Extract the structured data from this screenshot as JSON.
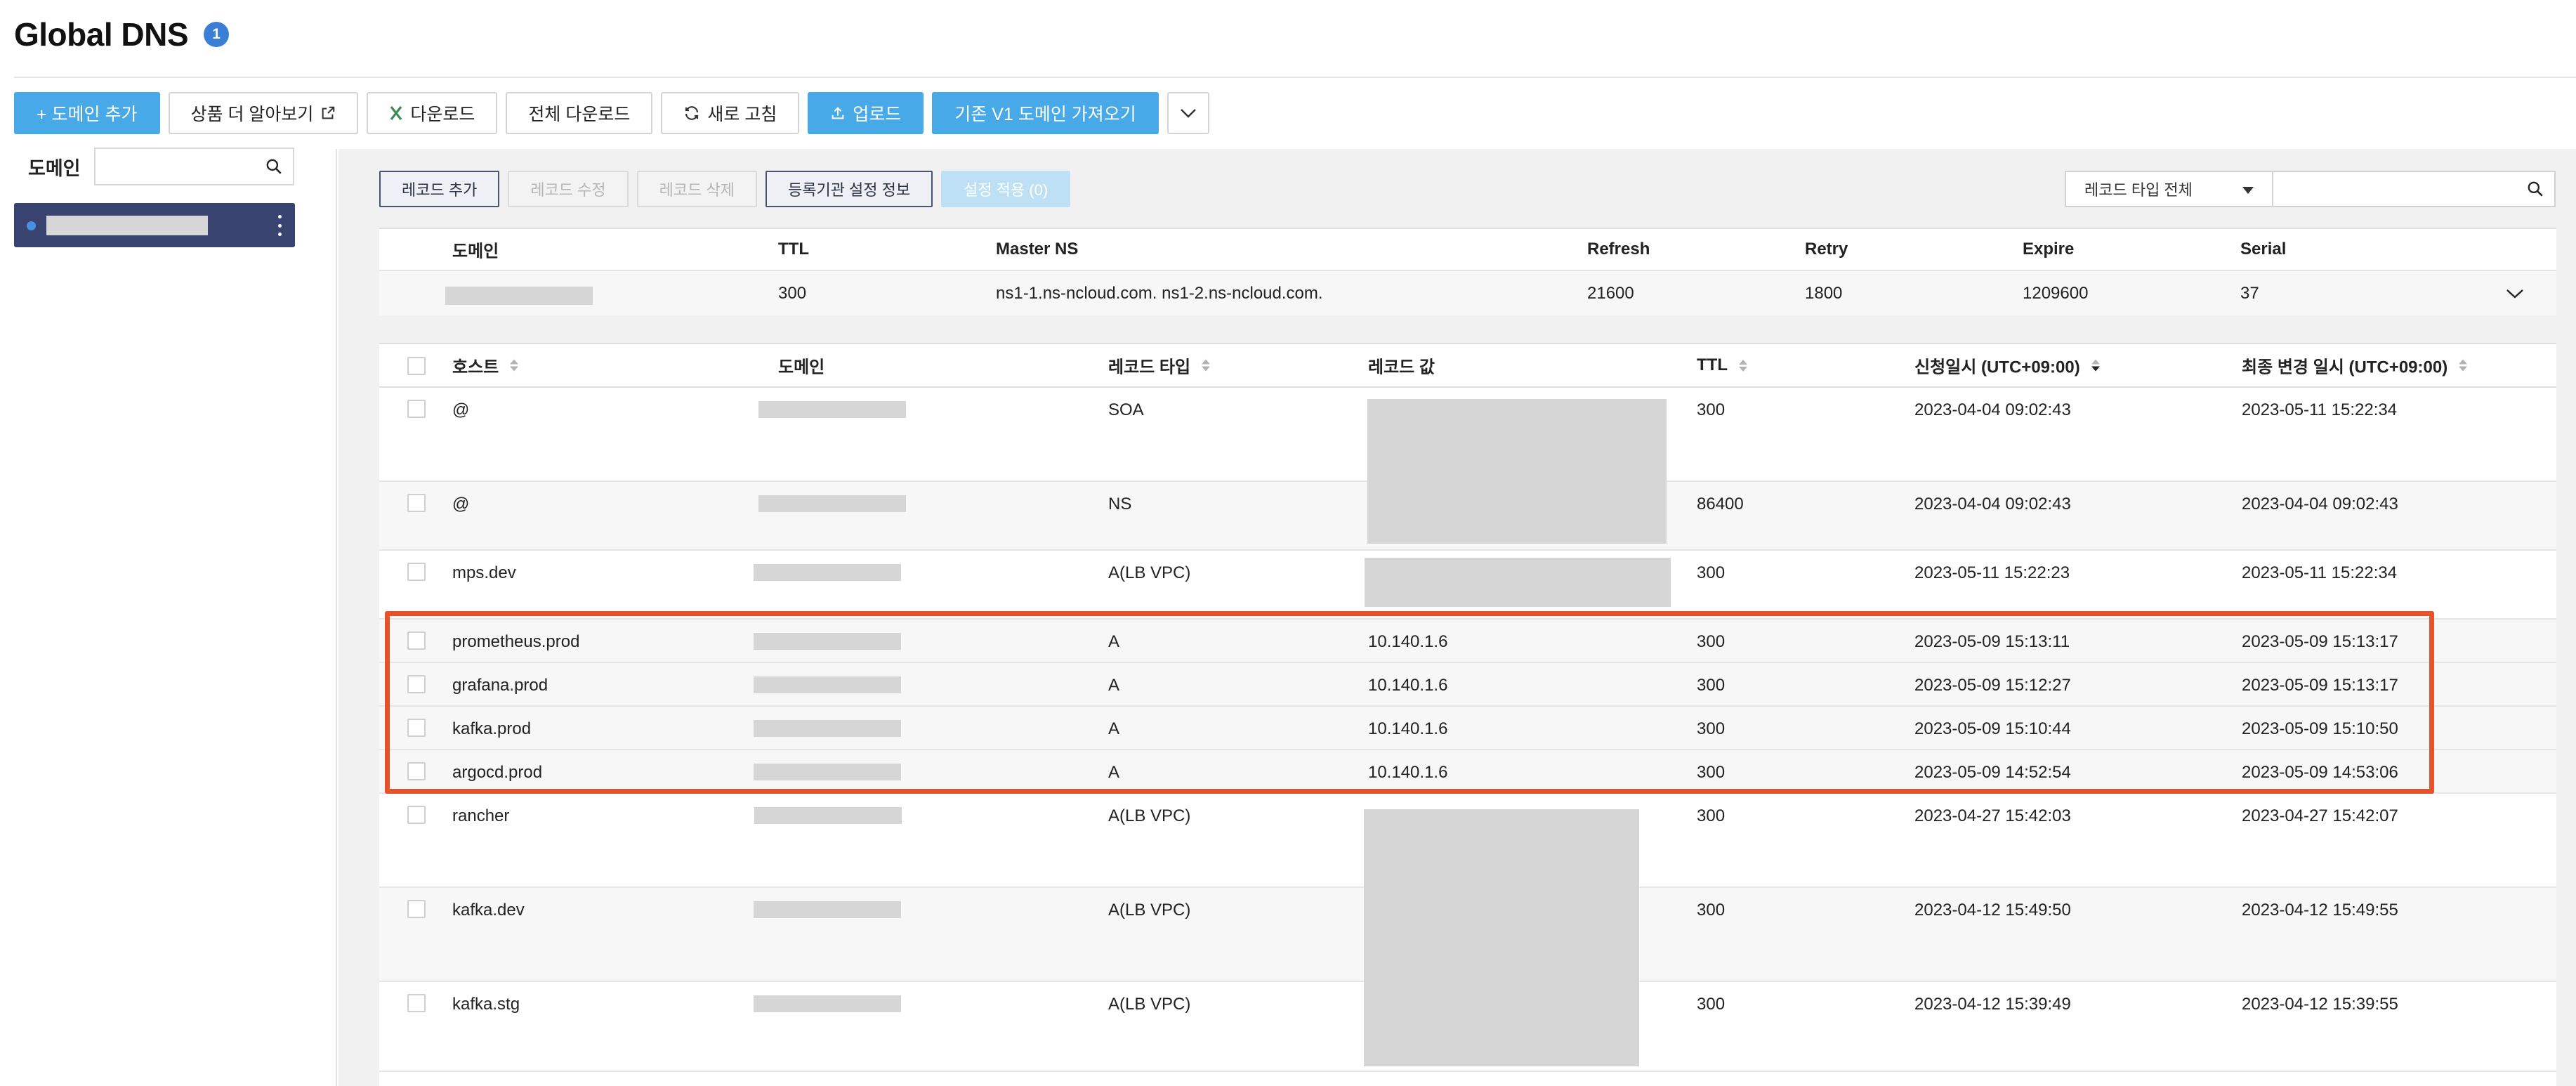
{
  "header": {
    "title": "Global DNS",
    "badge": "1"
  },
  "toolbar": {
    "add_domain": "+ 도메인 추가",
    "learn_more": "상품 더 알아보기",
    "download": "다운로드",
    "download_all": "전체 다운로드",
    "refresh": "새로 고침",
    "upload": "업로드",
    "import_v1": "기존 V1 도메인 가져오기"
  },
  "sidebar": {
    "domain_label": "도메인",
    "search_placeholder": ""
  },
  "record_toolbar": {
    "add": "레코드 추가",
    "edit": "레코드 수정",
    "delete": "레코드 삭제",
    "registrar": "등록기관 설정 정보",
    "apply": "설정 적용 (0)"
  },
  "filter": {
    "type_select": "레코드 타입 전체",
    "search_placeholder": ""
  },
  "soa": {
    "headers": {
      "domain": "도메인",
      "ttl": "TTL",
      "master_ns": "Master NS",
      "refresh": "Refresh",
      "retry": "Retry",
      "expire": "Expire",
      "serial": "Serial"
    },
    "row": {
      "ttl": "300",
      "master_ns": "ns1-1.ns-ncloud.com. ns1-2.ns-ncloud.com.",
      "refresh": "21600",
      "retry": "1800",
      "expire": "1209600",
      "serial": "37"
    }
  },
  "records": {
    "headers": {
      "host": "호스트",
      "domain": "도메인",
      "type": "레코드 타입",
      "value": "레코드 값",
      "ttl": "TTL",
      "requested": "신청일시 (UTC+09:00)",
      "modified": "최종 변경 일시 (UTC+09:00)"
    },
    "rows": [
      {
        "host": "@",
        "type": "SOA",
        "value": "",
        "ttl": "300",
        "requested": "2023-04-04 09:02:43",
        "modified": "2023-05-11 15:22:34"
      },
      {
        "host": "@",
        "type": "NS",
        "value": "",
        "ttl": "86400",
        "requested": "2023-04-04 09:02:43",
        "modified": "2023-04-04 09:02:43"
      },
      {
        "host": "mps.dev",
        "type": "A(LB VPC)",
        "value": "",
        "ttl": "300",
        "requested": "2023-05-11 15:22:23",
        "modified": "2023-05-11 15:22:34"
      },
      {
        "host": "prometheus.prod",
        "type": "A",
        "value": "10.140.1.6",
        "ttl": "300",
        "requested": "2023-05-09 15:13:11",
        "modified": "2023-05-09 15:13:17"
      },
      {
        "host": "grafana.prod",
        "type": "A",
        "value": "10.140.1.6",
        "ttl": "300",
        "requested": "2023-05-09 15:12:27",
        "modified": "2023-05-09 15:13:17"
      },
      {
        "host": "kafka.prod",
        "type": "A",
        "value": "10.140.1.6",
        "ttl": "300",
        "requested": "2023-05-09 15:10:44",
        "modified": "2023-05-09 15:10:50"
      },
      {
        "host": "argocd.prod",
        "type": "A",
        "value": "10.140.1.6",
        "ttl": "300",
        "requested": "2023-05-09 14:52:54",
        "modified": "2023-05-09 14:53:06"
      },
      {
        "host": "rancher",
        "type": "A(LB VPC)",
        "value": "",
        "ttl": "300",
        "requested": "2023-04-27 15:42:03",
        "modified": "2023-04-27 15:42:07"
      },
      {
        "host": "kafka.dev",
        "type": "A(LB VPC)",
        "value": "",
        "ttl": "300",
        "requested": "2023-04-12 15:49:50",
        "modified": "2023-04-12 15:49:55"
      },
      {
        "host": "kafka.stg",
        "type": "A(LB VPC)",
        "value": "",
        "ttl": "300",
        "requested": "2023-04-12 15:39:49",
        "modified": "2023-04-12 15:39:55"
      }
    ]
  },
  "colors": {
    "primary": "#47a9e8",
    "selected_domain": "#384370",
    "highlight": "#e4532b",
    "badge": "#3a7fd5"
  }
}
